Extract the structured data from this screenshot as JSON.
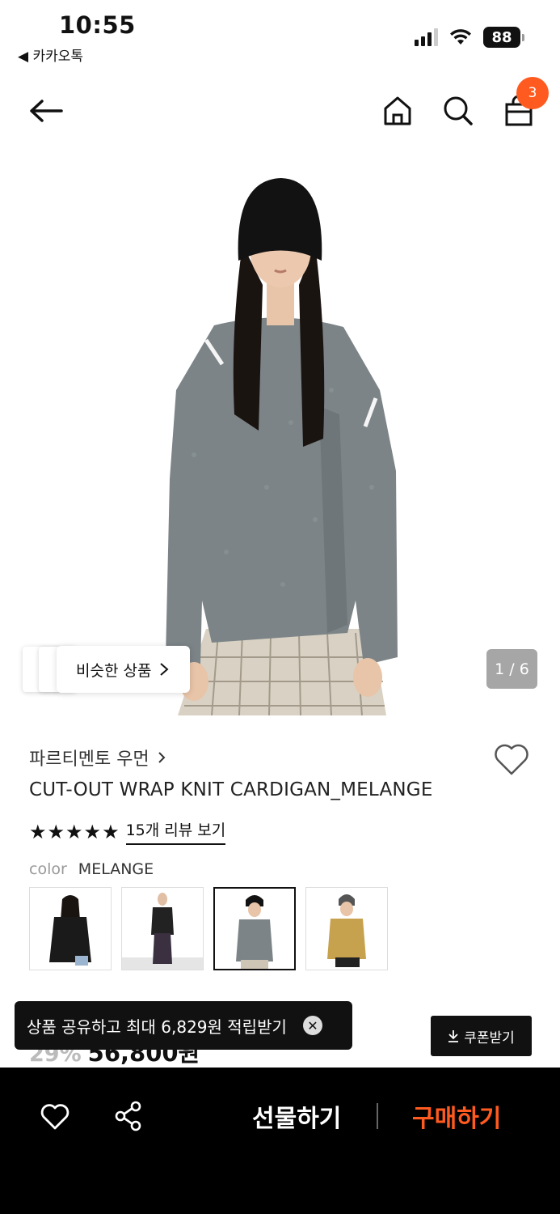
{
  "status_bar": {
    "time": "10:55",
    "back_app": "◀ 카카오톡",
    "battery": "88",
    "signal_bars": 3,
    "wifi": true
  },
  "nav": {
    "back_icon": "arrow-left-icon",
    "home_icon": "home-icon",
    "search_icon": "search-icon",
    "cart_icon": "shopping-bag-icon",
    "cart_count": "3"
  },
  "gallery": {
    "counter": "1 / 6",
    "similar_label": "비슷한 상품",
    "current_page": 1,
    "total_pages": 6
  },
  "product": {
    "brand": "파르티멘토 우먼",
    "name": "CUT-OUT WRAP KNIT CARDIGAN_MELANGE",
    "rating_stars": 5,
    "review_link": "15개 리뷰 보기",
    "color_label": "color",
    "color_value": "MELANGE",
    "swatches": [
      {
        "name": "black",
        "color": "#1a1a1a"
      },
      {
        "name": "black-full",
        "color": "#222222"
      },
      {
        "name": "melange",
        "color": "#7c8487",
        "selected": true
      },
      {
        "name": "mustard",
        "color": "#c7a24e"
      }
    ],
    "discount": "29%",
    "price": "56,800원"
  },
  "toast": {
    "message": "상품 공유하고 최대 6,829원 적립받기"
  },
  "coupon": {
    "label": "쿠폰받기"
  },
  "bottom_bar": {
    "gift_label": "선물하기",
    "buy_label": "구매하기"
  },
  "colors": {
    "accent": "#ff5a1f",
    "dark": "#111111"
  }
}
